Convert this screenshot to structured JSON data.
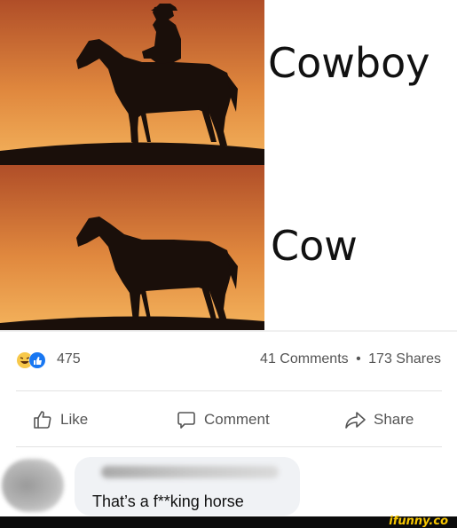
{
  "meme": {
    "caption_top": "Cowboy",
    "caption_bottom": "Cow"
  },
  "stats": {
    "reaction_count": "475",
    "comments": "41 Comments",
    "separator": "•",
    "shares": "173 Shares",
    "reaction_icons": [
      "laugh-reaction-icon",
      "like-reaction-icon"
    ]
  },
  "actions": {
    "like_label": "Like",
    "comment_label": "Comment",
    "share_label": "Share"
  },
  "comment": {
    "text": "That’s a f**king horse"
  },
  "watermark": {
    "text": "ifunny.co"
  },
  "colors": {
    "sky_top": "#b8542a",
    "sky_bottom": "#f3b05a",
    "silhouette": "#1a0f0a",
    "watermark": "#f7c600",
    "like_blue": "#1877f2",
    "laugh_yellow": "#f7c84a"
  }
}
